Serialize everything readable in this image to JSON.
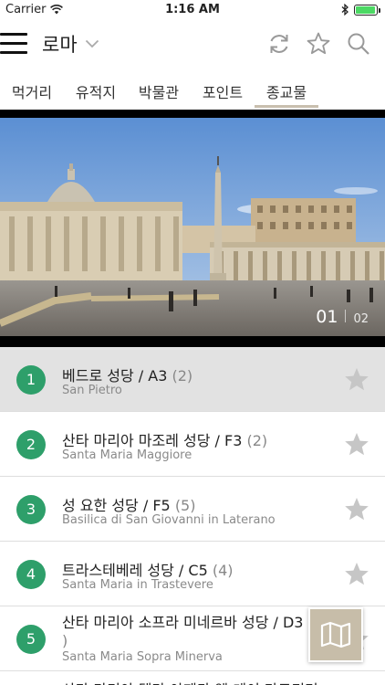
{
  "status_bar": {
    "carrier": "Carrier",
    "time": "1:16 AM",
    "battery_level": 1.0
  },
  "header": {
    "city": "로마"
  },
  "tabs": [
    {
      "label": "먹거리"
    },
    {
      "label": "유적지"
    },
    {
      "label": "박물관"
    },
    {
      "label": "포인트"
    },
    {
      "label": "종교물",
      "active": true
    }
  ],
  "hero": {
    "current": "01",
    "total": "02"
  },
  "places": [
    {
      "num": "1",
      "name": "베드로 성당 / A3",
      "count": "(2)",
      "subtitle": "San Pietro",
      "selected": true
    },
    {
      "num": "2",
      "name": "산타 마리아 마조레 성당 / F3",
      "count": "(2)",
      "subtitle": "Santa Maria Maggiore"
    },
    {
      "num": "3",
      "name": "성 요한 성당 / F5",
      "count": "(5)",
      "subtitle": "Basilica di San Giovanni in Laterano"
    },
    {
      "num": "4",
      "name": "트라스테베레 성당 / C5",
      "count": "(4)",
      "subtitle": "Santa Maria in Trastevere"
    },
    {
      "num": "5",
      "name": "산타 마리아 소프라 미네르바 성당 / D3",
      "count": ")",
      "subtitle": "Santa Maria Sopra Minerva"
    },
    {
      "name": "산타 마리아 델라 아제카 엘 데이 마르티리"
    }
  ],
  "colors": {
    "accent_green": "#2e9f6a",
    "tab_underline": "#c8bfae",
    "map_button": "#c7bda9",
    "star_gray": "#c6c6c6"
  },
  "icons": {
    "menu": "hamburger-icon",
    "refresh": "refresh-icon",
    "favorite": "star-outline-icon",
    "search": "search-icon",
    "map": "map-icon"
  }
}
